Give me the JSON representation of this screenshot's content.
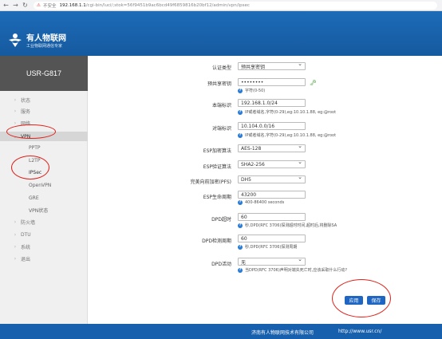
{
  "browser": {
    "security_label": "不安全",
    "url_host": "192.168.1.1",
    "url_path": "/cgi-bin/luci/;stok=56f9451b9ac6bcd49f6859816b20bf12/admin/vpn/ipsec"
  },
  "header": {
    "brand": "有人物联网",
    "tagline": "工业物联网通信专家"
  },
  "sidebar": {
    "model": "USR-G817",
    "items": [
      {
        "label": "状态"
      },
      {
        "label": "服务"
      },
      {
        "label": "网络"
      },
      {
        "label": "VPN"
      },
      {
        "label": "防火墙"
      },
      {
        "label": "DTU"
      },
      {
        "label": "系统"
      },
      {
        "label": "退出"
      }
    ],
    "vpn_sub": [
      {
        "label": "PPTP"
      },
      {
        "label": "L2TP"
      },
      {
        "label": "IPSec"
      },
      {
        "label": "OpenVPN"
      },
      {
        "label": "GRE"
      },
      {
        "label": "VPN状态"
      }
    ]
  },
  "form": {
    "auth_type": {
      "label": "认证类型",
      "value": "预共享密钥"
    },
    "psk": {
      "label": "预共享密钥",
      "value": "••••••••",
      "hint": "字符(0-50)"
    },
    "local_subnet": {
      "label": "本端标识",
      "value": "192.168.1.0/24",
      "hint": "IP或者域名,字符(0-29),eg:10.10.1.88, eg:@root"
    },
    "remote_subnet": {
      "label": "对端标识",
      "value": "10.104.0.0/16",
      "hint": "IP或者域名,字符(0-29),eg:10.10.1.88, eg:@root"
    },
    "esp_enc": {
      "label": "ESP加密算法",
      "value": "AES-128"
    },
    "esp_auth": {
      "label": "ESP验证算法",
      "value": "SHA2-256"
    },
    "pfs": {
      "label": "完美向前加密(PFS)",
      "value": "DH5"
    },
    "esp_lifetime": {
      "label": "ESP生命周期",
      "value": "43200",
      "hint": "400-86400 seconds"
    },
    "dpd_timeout": {
      "label": "DPD超时",
      "value": "60",
      "hint": "秒,DPD(RFC 3706)探测超时时间,超时后,将删除SA"
    },
    "dpd_interval": {
      "label": "DPD检测周期",
      "value": "60",
      "hint": "秒,DPD(RFC 3706)探测周期"
    },
    "dpd_action": {
      "label": "DPD活动",
      "value": "无",
      "hint": "当DPD(RFC 3706)声明对端失死亡时,应该采取什么行动?"
    },
    "apply_label": "应用",
    "save_label": "保存"
  },
  "footer": {
    "company": "济南有人物联网技术有限公司",
    "url": "http://www.usr.cn/"
  },
  "colors": {
    "header_blue": "#1760ad",
    "button_blue": "#1e66c2",
    "annotation_red": "#e0221c"
  }
}
